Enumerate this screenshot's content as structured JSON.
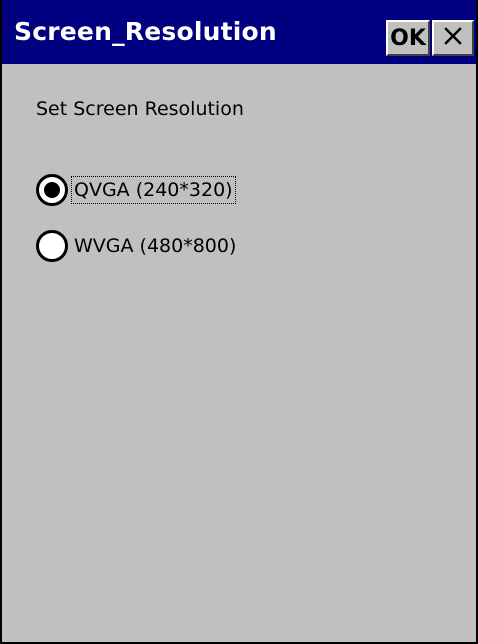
{
  "window": {
    "title": "Screen_Resolution",
    "ok_label": "OK",
    "close_label": "✕"
  },
  "content": {
    "heading": "Set Screen Resolution",
    "options": [
      {
        "label": "QVGA (240*320)",
        "selected": true,
        "focused": true
      },
      {
        "label": "WVGA (480*800)",
        "selected": false,
        "focused": false
      }
    ]
  },
  "colors": {
    "titlebar": "#000080",
    "title_text": "#ffffff",
    "background": "#c0c0c0"
  }
}
